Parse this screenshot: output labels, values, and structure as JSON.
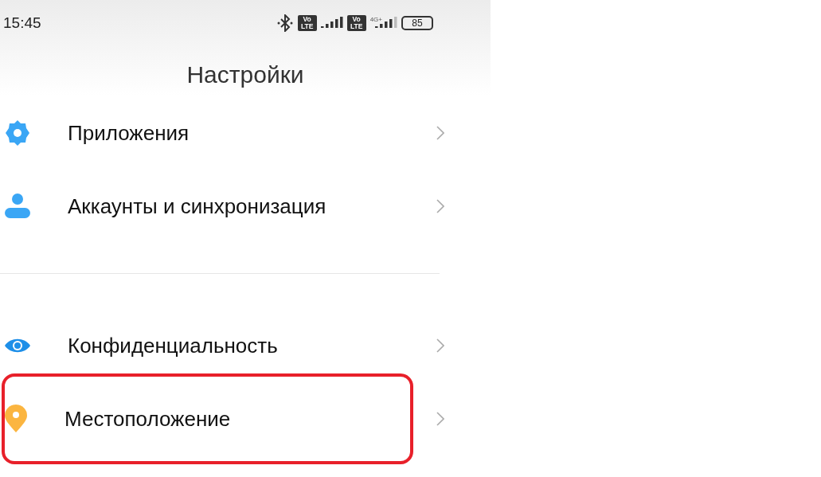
{
  "status_bar": {
    "time": "15:45",
    "sims": [
      {
        "badge_top": "Vo",
        "badge_bottom": "LTE"
      },
      {
        "badge_top": "Vo",
        "badge_bottom": "LTE",
        "network": "4G+"
      }
    ],
    "battery": "85"
  },
  "title": "Настройки",
  "groups": [
    {
      "items": [
        {
          "kind": "gear",
          "label": "Приложения",
          "highlighted": false
        },
        {
          "kind": "person",
          "label": "Аккаунты и синхронизация",
          "highlighted": false
        }
      ]
    },
    {
      "items": [
        {
          "kind": "eye",
          "label": "Конфиденциальность",
          "highlighted": false
        },
        {
          "kind": "pin",
          "label": "Местоположение",
          "highlighted": true
        }
      ]
    }
  ]
}
